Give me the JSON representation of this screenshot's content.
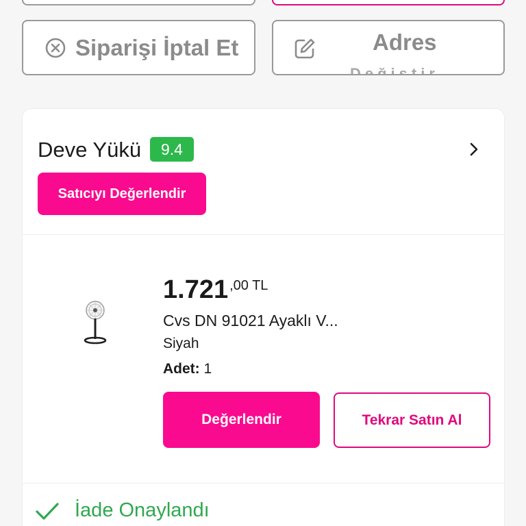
{
  "actions": {
    "cancel_order_label": "Siparişi İptal Et",
    "address_label": "Adres",
    "address_label_cut": "Değiştir"
  },
  "seller": {
    "name": "Deve Yükü",
    "rating": "9.4",
    "rate_button": "Satıcıyı Değerlendir"
  },
  "product": {
    "price_main": "1.721",
    "price_decimals": ",00 TL",
    "name": "Cvs DN 91021 Ayaklı V...",
    "color": "Siyah",
    "quantity_label": "Adet:",
    "quantity_value": "1",
    "review_button": "Değerlendir",
    "rebuy_button": "Tekrar Satın Al"
  },
  "status": {
    "text": "İade Onaylandı"
  },
  "colors": {
    "brand": "#fa0a8e",
    "success": "#2db84b"
  },
  "icons": {
    "cancel": "x-circle-icon",
    "edit": "edit-pencil-icon",
    "chevron": "chevron-right-icon",
    "status": "check-icon"
  }
}
